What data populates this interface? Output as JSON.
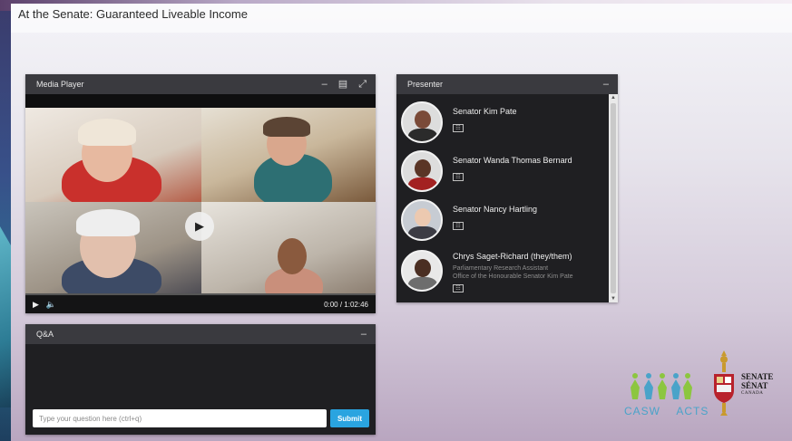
{
  "page": {
    "title": "At the Senate: Guaranteed Liveable Income"
  },
  "media_player": {
    "title": "Media Player",
    "time": "0:00 / 1:02:46",
    "icons": [
      "minimize-icon",
      "maximize-icon",
      "fullscreen-icon",
      "play-icon",
      "volume-icon"
    ]
  },
  "presenter_panel": {
    "title": "Presenter",
    "presenters": [
      {
        "name": "Senator Kim Pate",
        "subtitle_1": "",
        "subtitle_2": ""
      },
      {
        "name": "Senator Wanda Thomas Bernard",
        "subtitle_1": "",
        "subtitle_2": ""
      },
      {
        "name": "Senator Nancy Hartling",
        "subtitle_1": "",
        "subtitle_2": ""
      },
      {
        "name": "Chrys Saget-Richard (they/them)",
        "subtitle_1": "Parliamentary Research Assistant",
        "subtitle_2": "Office of the Honourable Senator Kim Pate"
      }
    ]
  },
  "qa": {
    "title": "Q&A",
    "input_placeholder": "Type your question here (ctrl+q)",
    "input_value": "",
    "submit_label": "Submit"
  },
  "logos": {
    "casw_left": "CASW",
    "casw_right": "ACTS",
    "senate_en": "SENATE",
    "senate_fr": "SÉNAT",
    "senate_country": "CANADA"
  },
  "colors": {
    "accent": "#2aa4e0",
    "panel_header": "#3a3a3f",
    "panel_body": "#1f1f22",
    "casw_teal": "#4aa3c9",
    "casw_green": "#8cc63f"
  }
}
